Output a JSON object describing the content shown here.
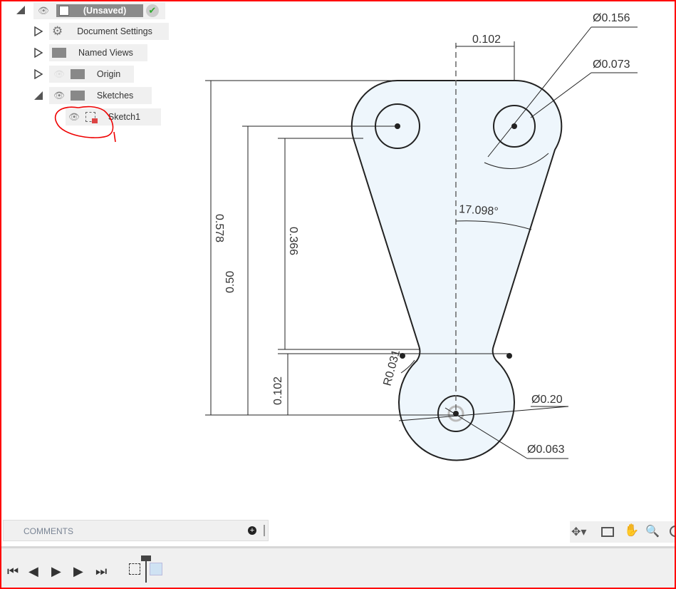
{
  "browser": {
    "root": {
      "label": "(Unsaved)",
      "icon": "component-icon",
      "status_icon": "check-icon"
    },
    "items": [
      {
        "label": "Document Settings",
        "icon": "gear-icon"
      },
      {
        "label": "Named Views",
        "icon": "folder-icon"
      },
      {
        "label": "Origin",
        "icon": "folder-icon",
        "visibility": "hidden"
      },
      {
        "label": "Sketches",
        "icon": "folder-icon",
        "expanded": true
      },
      {
        "label": "Sketch1",
        "icon": "sketch-icon",
        "locked": true
      }
    ]
  },
  "sketch": {
    "fill_color": "#eef6fc",
    "dimensions": {
      "top_width": "0.102",
      "big_hole_dia": "Ø0.156",
      "small_hole_dia": "Ø0.073",
      "angle": "17.098°",
      "overall_height": "0.578",
      "hole_spacing": "0.50",
      "taper_length": "0.366",
      "neck_height": "0.102",
      "fillet_radius": "R0.031",
      "bottom_dia": "Ø0.20",
      "bottom_hole_dia": "Ø0.063"
    }
  },
  "comments": {
    "label": "COMMENTS"
  },
  "navbar": {
    "icons": [
      "orbit-icon",
      "look-at-icon",
      "pan-icon",
      "zoom-icon",
      "display-icon"
    ]
  },
  "timeline": {
    "controls": [
      "first",
      "previous",
      "play",
      "next",
      "last"
    ]
  }
}
